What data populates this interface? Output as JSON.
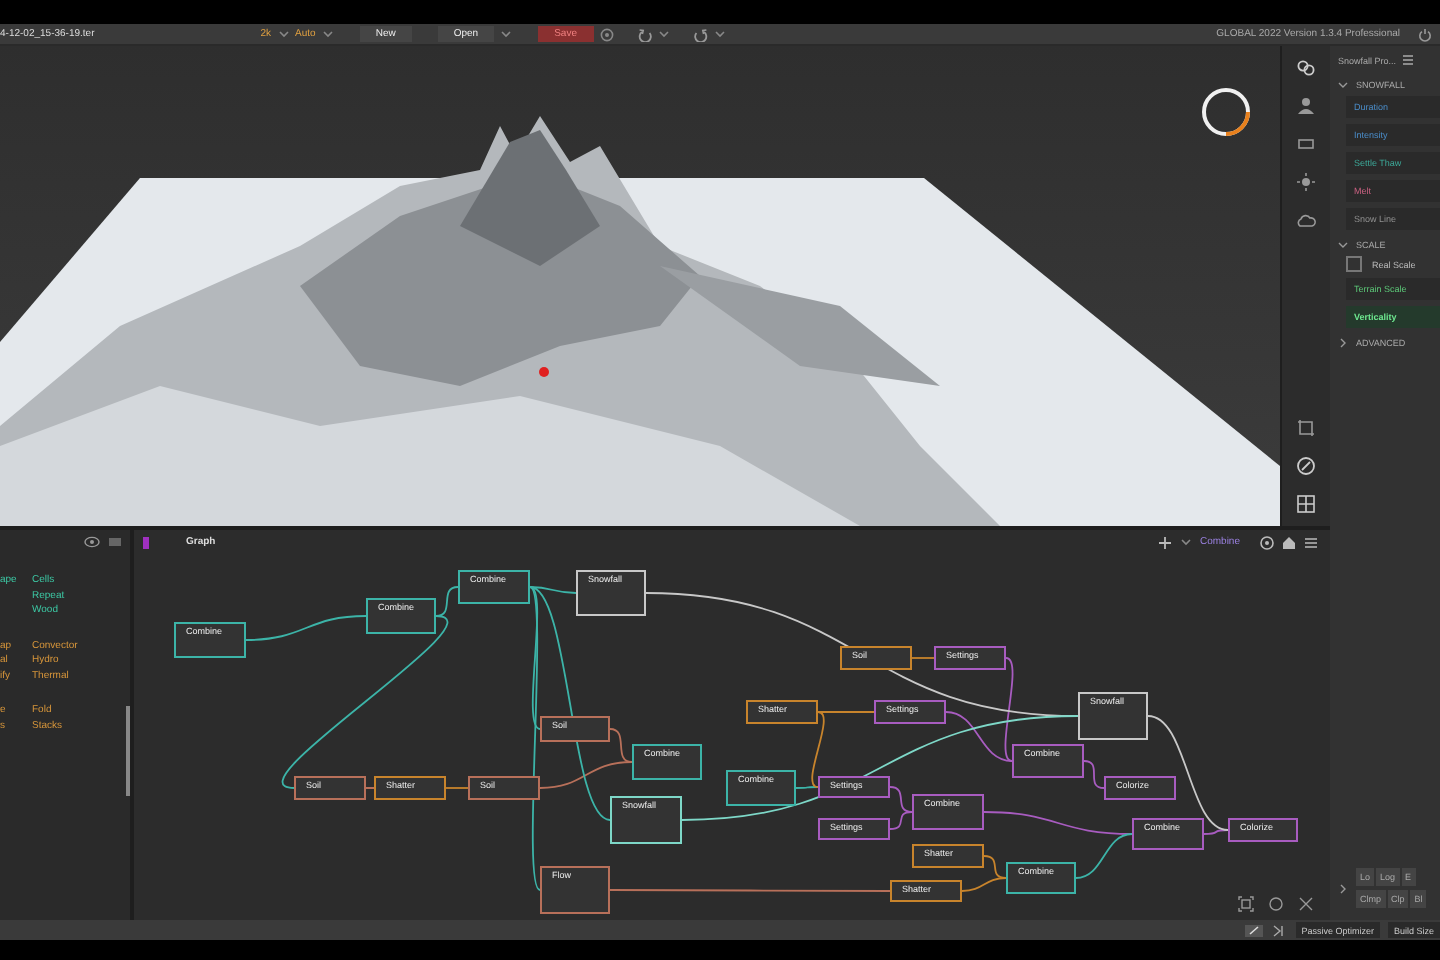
{
  "toolbar": {
    "file": "4-12-02_15-36-19.ter",
    "resolution": "2k",
    "mode": "Auto",
    "buttons": [
      {
        "label": "New",
        "kind": "plain"
      },
      {
        "label": "Open",
        "kind": "menu"
      },
      {
        "label": "Save",
        "kind": "danger"
      }
    ],
    "title": "GLOBAL 2022 Version 1.3.4 Professional"
  },
  "library": {
    "groups": [
      {
        "left": [
          "ape"
        ],
        "right": [
          "Cells",
          "Repeat",
          "Wood"
        ]
      },
      {
        "left": [
          "ap",
          "al",
          "ify"
        ],
        "right": [
          "Convector",
          "Hydro",
          "Thermal"
        ]
      },
      {
        "left": [
          "e",
          "s"
        ],
        "right": [
          "Fold",
          "Stacks"
        ]
      }
    ]
  },
  "graph": {
    "title": "Graph",
    "current": "Combine",
    "nodes": [
      {
        "label": "Combine",
        "color": "#3cb4a8"
      },
      {
        "label": "Snowfall",
        "color": "#c8c8c8"
      },
      {
        "label": "Combine",
        "color": "#3cb4a8"
      },
      {
        "label": "Combine",
        "color": "#3cb4a8"
      },
      {
        "label": "Soil",
        "color": "#b8705a"
      },
      {
        "label": "Combine",
        "color": "#3cb4a8"
      },
      {
        "label": "Soil",
        "color": "#b8705a"
      },
      {
        "label": "Shatter",
        "color": "#c8842c"
      },
      {
        "label": "Soil",
        "color": "#b8705a"
      },
      {
        "label": "Snowfall",
        "color": "#7ed8c8"
      },
      {
        "label": "Flow",
        "color": "#b8705a"
      },
      {
        "label": "Soil",
        "color": "#c8842c"
      },
      {
        "label": "Settings",
        "color": "#a85cc0"
      },
      {
        "label": "Shatter",
        "color": "#c8842c"
      },
      {
        "label": "Settings",
        "color": "#a85cc0"
      },
      {
        "label": "Snowfall",
        "color": "#c8c8c8"
      },
      {
        "label": "Combine",
        "color": "#3cb4a8"
      },
      {
        "label": "Settings",
        "color": "#a85cc0"
      },
      {
        "label": "Combine",
        "color": "#a85cc0"
      },
      {
        "label": "Colorize",
        "color": "#a85cc0"
      },
      {
        "label": "Combine",
        "color": "#a85cc0"
      },
      {
        "label": "Settings",
        "color": "#a85cc0"
      },
      {
        "label": "Combine",
        "color": "#a85cc0"
      },
      {
        "label": "Colorize",
        "color": "#a85cc0"
      },
      {
        "label": "Shatter",
        "color": "#c8842c"
      },
      {
        "label": "Combine",
        "color": "#3cb4a8"
      },
      {
        "label": "Shatter",
        "color": "#c8842c"
      }
    ]
  },
  "properties": {
    "title": "Snowfall Pro...",
    "sections": [
      {
        "label": "SNOWFALL",
        "expanded": true,
        "rows": [
          {
            "kind": "field",
            "label": "Duration",
            "selected": false
          },
          {
            "kind": "field",
            "label": "Intensity",
            "selected": false
          },
          {
            "kind": "field",
            "label": "Settle Thaw",
            "selected": false
          },
          {
            "kind": "field",
            "label": "Melt",
            "selected": false
          },
          {
            "kind": "field",
            "label": "Snow Line",
            "selected": false
          }
        ]
      },
      {
        "label": "SCALE",
        "expanded": true,
        "rows": [
          {
            "kind": "checkbox",
            "label": "Real Scale",
            "checked": false
          },
          {
            "kind": "field",
            "label": "Terrain Scale",
            "selected": false
          },
          {
            "kind": "field",
            "label": "Verticality",
            "selected": true
          }
        ]
      },
      {
        "label": "ADVANCED",
        "expanded": false
      }
    ],
    "mappings": [
      [
        "Lo",
        "Log",
        "E"
      ],
      [
        "Clmp",
        "Clp",
        "Bl"
      ]
    ]
  },
  "status": {
    "buttons": [
      "Passive Optimizer",
      "Build Size"
    ]
  }
}
